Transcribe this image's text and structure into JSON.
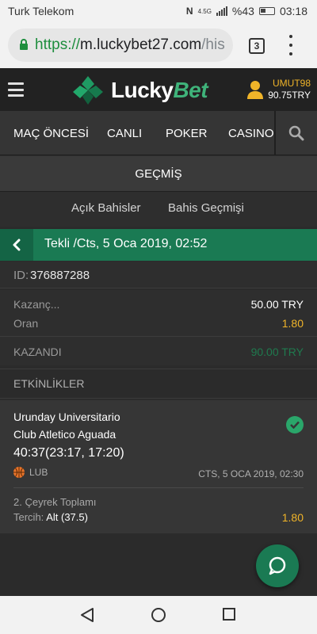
{
  "status_bar": {
    "carrier": "Turk Telekom",
    "network": "4.5G",
    "battery": "%43",
    "time": "03:18"
  },
  "browser": {
    "url_scheme": "https://",
    "url_host": "m.luckybet27.com",
    "url_path": "/his",
    "tab_count": "3"
  },
  "header": {
    "logo_part1": "Lucky",
    "logo_part2": "Bet",
    "username": "UMUT98",
    "balance": "90.75TRY"
  },
  "nav": {
    "items": [
      "MAÇ ÖNCESİ",
      "CANLI",
      "POKER",
      "CASINO"
    ]
  },
  "section": {
    "title": "GEÇMİŞ",
    "tabs": [
      "Açık Bahisler",
      "Bahis Geçmişi"
    ]
  },
  "bet": {
    "header_title": "Tekli /Cts, 5 Oca 2019, 02:52",
    "id_label": "ID:",
    "id_value": "376887288",
    "stake_label": "Kazanç...",
    "stake_value": "50.00 TRY",
    "odds_label": "Oran",
    "odds_value": "1.80",
    "result_label": "KAZANDI",
    "result_value": "90.00 TRY"
  },
  "events": {
    "header": "ETKİNLİKLER",
    "items": [
      {
        "team1": "Urunday Universitario",
        "team2": "Club Atletico Aguada",
        "score": "40:37(23:17, 17:20)",
        "league": "LUB",
        "date": "CTS, 5 OCA 2019, 02:30",
        "market": "2. Çeyrek Toplamı",
        "pick_label": "Tercih:",
        "pick_value": "Alt (37.5)",
        "odds": "1.80"
      }
    ]
  },
  "colors": {
    "brand_green": "#1a7a53",
    "win_green": "#2aa66a",
    "accent_gold": "#f0b429"
  }
}
